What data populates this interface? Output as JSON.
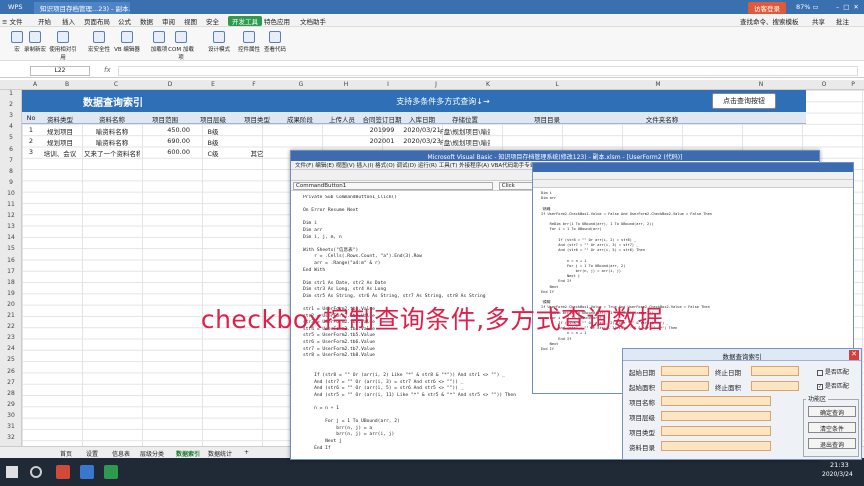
{
  "titlebar": {
    "app": "WPS",
    "tab": "知识项目存档管理...23) - 副本.xlsm",
    "login": "访客登录",
    "win_ctrl": "87% ▭"
  },
  "menubar": {
    "items": [
      "≡ 文件",
      "开始",
      "插入",
      "页面布局",
      "公式",
      "数据",
      "审阅",
      "视图",
      "安全",
      "开发工具",
      "特色应用",
      "文档助手"
    ],
    "active_index": 9,
    "search": "查找命令、搜索模板",
    "right": [
      "共享",
      "批注"
    ]
  },
  "toolbar": {
    "buttons": [
      "宏",
      "录制新宏",
      "使用相对引用",
      "宏安全性",
      "VB 编辑器",
      "加载项",
      "COM 加载项",
      "设计模式",
      "控件属性",
      "查看代码"
    ]
  },
  "formulabar": {
    "namebox": "L22",
    "fx": "fx"
  },
  "columns": [
    "A",
    "B",
    "C",
    "D",
    "E",
    "F",
    "G",
    "H",
    "I",
    "J",
    "K",
    "L",
    "M",
    "N",
    "O",
    "P"
  ],
  "rows": [
    "1",
    "2",
    "3",
    "4",
    "5",
    "6",
    "7",
    "8",
    "9",
    "10",
    "11",
    "12",
    "13",
    "14",
    "15",
    "16",
    "17",
    "18",
    "19",
    "20",
    "21",
    "22",
    "23",
    "24",
    "25",
    "26",
    "27",
    "28",
    "29",
    "30",
    "31",
    "32"
  ],
  "sheet": {
    "title_left": "数据查询索引",
    "title_mid": "支持多条件多方式查询↓→",
    "button": "点击查询按钮",
    "headers": [
      "No",
      "资料类型",
      "资料名称",
      "项目范围",
      "项目层级",
      "项目类型",
      "成果阶段",
      "上传人员",
      "合同签订日期",
      "入库日期",
      "存储位置",
      "项目目录",
      "文件夹名称"
    ],
    "data": [
      [
        "1",
        "规划项目",
        "喻资料名称",
        "450.00",
        "B级",
        "",
        "",
        "",
        "201999",
        "2020/03/21",
        "F盘\\规划项目\\喻资料名称",
        "",
        ""
      ],
      [
        "2",
        "规划项目",
        "喻资料名称",
        "690.00",
        "B级",
        "",
        "",
        "",
        "202001",
        "2020/03/23",
        "F盘\\规划项目\\喻资料名称",
        "",
        ""
      ],
      [
        "3",
        "培训、会议",
        "又来了一个资料名称",
        "600.00",
        "C级",
        "其它",
        "",
        "",
        "",
        "",
        "",
        "",
        ""
      ]
    ]
  },
  "sheettabs": [
    "首页",
    "设置",
    "信息表",
    "层级分类",
    "数据索引",
    "数据统计",
    "+"
  ],
  "sheettabs_active": 4,
  "vbe": {
    "title": "Microsoft Visual Basic - 知识项目存档管理系统(修改123) - 副本.xlsm - [UserForm2 (代码)]",
    "menu": "文件(F)  编辑(E)  视图(V)  插入(I)  格式(O)  调试(D)  运行(R)  工具(T)  外接程序(A)  VBA代码助手专业版(B)  窗口(W)  帮助(H)",
    "combo_left": "CommandButton1",
    "combo_right": "Click",
    "code": "Private Sub CommandButton1_Click()\n\nOn Error Resume Next\n\nDim i\nDim arr\nDim i, j, m, n\n\nWith Sheets(\"信息表\")\n    r = .Cells(.Rows.Count, \"a\").End(3).Row\n    arr = .Range(\"a4:m\" & r)\nEnd With\n\nDim str1 As Date, str2 As Date\nDim str3 As Long, str4 As Long\nDim str5 As String, str6 As String, str7 As String, str8 As String\n\nstr1 = UserForm2.tb1.Value\nstr2 = UserForm2.tb2.Value\nstr3 = UserForm2.tb3.Value\nstr4 = UserForm2.tb4.Value\nstr5 = UserForm2.tb5.Value\nstr6 = UserForm2.tb6.Value\nstr7 = UserForm2.tb7.Value\nstr8 = UserForm2.tb8.Value\n\n\n    If (str8 = \"\" Or (arr(i, 2) Like \"*\" & str8 & \"*\")) And str1 <> \"\") _\n    And (str7 = \"\" Or (arr(i, 3) = str7 And str6 <> \"\")) _\n    And (str6 = \"\" Or (arr(i, 5) = str6 And str5 <> \"\")) _\n    And (str5 = \"\" Or (arr(i, 11) Like \"*\" & str5 & \"*\" And str5 <> \"\")) Then\n\n    n = n + 1\n\n        For j = 1 To UBound(arr, 2)\n            brr(n, j) = a\n            brr(n, j) = arr(i, j)\n        Next j\n    End If\n\nNext\nEnd If\n\n'精确\nIf UserForm2.CheckBox1.Value = True And UserForm2.CheckBox2.Value = True Then\n    ReDim brr(1 To UBound(arr), 1 To UBound(arr, 2) + 1)\n    For i = 1 To UBound(arr)\n\n        If (CDate(arr(i, 9)) >= str1 And CDate(arr(i, 9)) <= str2 And arr(i, 3) >= str3 And arr(i, 3) <= str4 _\n        And (str8 = \"\" Or (arr(i, 2) Like \"*\" & str8 & \"*\")) _\n        And (str7 = \"\" Or (arr(i, 3) = str7 And str6 <> \"\")) _\n        And (str6 = \"\" Or (arr(i, 5) = str6 And str5 <> \"\")) _\n        And (str5 = \"\" Or (arr(i, 11) Like \"*\" & str5 & \"*\" And str5 <> \"\")) Then\n        n = n + 1"
  },
  "vbe2": {
    "code": "Dim i\nDim arr\n\n'精确\nIf UserForm2.CheckBox1.Value = False And UserForm2.CheckBox2.Value = False Then\n\n    ReDim brr(1 To UBound(arr), 1 To UBound(arr, 2))\n    For i = 1 To UBound(arr)\n\n        If (str8 = \"\" Or arr(i, 2) = str8) _\n        And (str7 = \"\" Or arr(i, 3) = str7) _\n        And (str6 = \"\" Or arr(i, 5) = str6) Then\n\n            n = n + 1\n            For j = 1 To UBound(arr, 2)\n                brr(n, j) = arr(i, j)\n            Next j\n        End If\n    Next\nEnd If\n\n'模糊\nIf UserForm2.CheckBox1.Value = True And UserForm2.CheckBox2.Value = False Then\n    ReDim brr(1 To UBound(arr), 1 To UBound(arr, 2))\n    For i = 1 To UBound(arr)\n        If (str8 = \"\" Or arr(i, 2) Like \"*\" & str8 & \"*\") _\n        And (str7 = \"\" Or arr(i, 3) Like \"*\" & str7 & \"*\") Then\n            n = n + 1\n        End If\n    Next\nEnd If"
  },
  "overlay_text": "checkbox控制查询条件,多方式查询数据",
  "userform": {
    "title": "数据查询索引",
    "labels": [
      "起始日期",
      "起始面积",
      "项目名称",
      "项目层级",
      "项目类型",
      "资料目录"
    ],
    "labels_right": [
      "终止日期",
      "终止面积"
    ],
    "check1": "是否匹配",
    "check2": "是否匹配",
    "frame": "功能区",
    "buttons": [
      "确定查询",
      "清空条件",
      "退出查询"
    ]
  },
  "status": {
    "time": "21:33",
    "date": "2020/3/24"
  }
}
